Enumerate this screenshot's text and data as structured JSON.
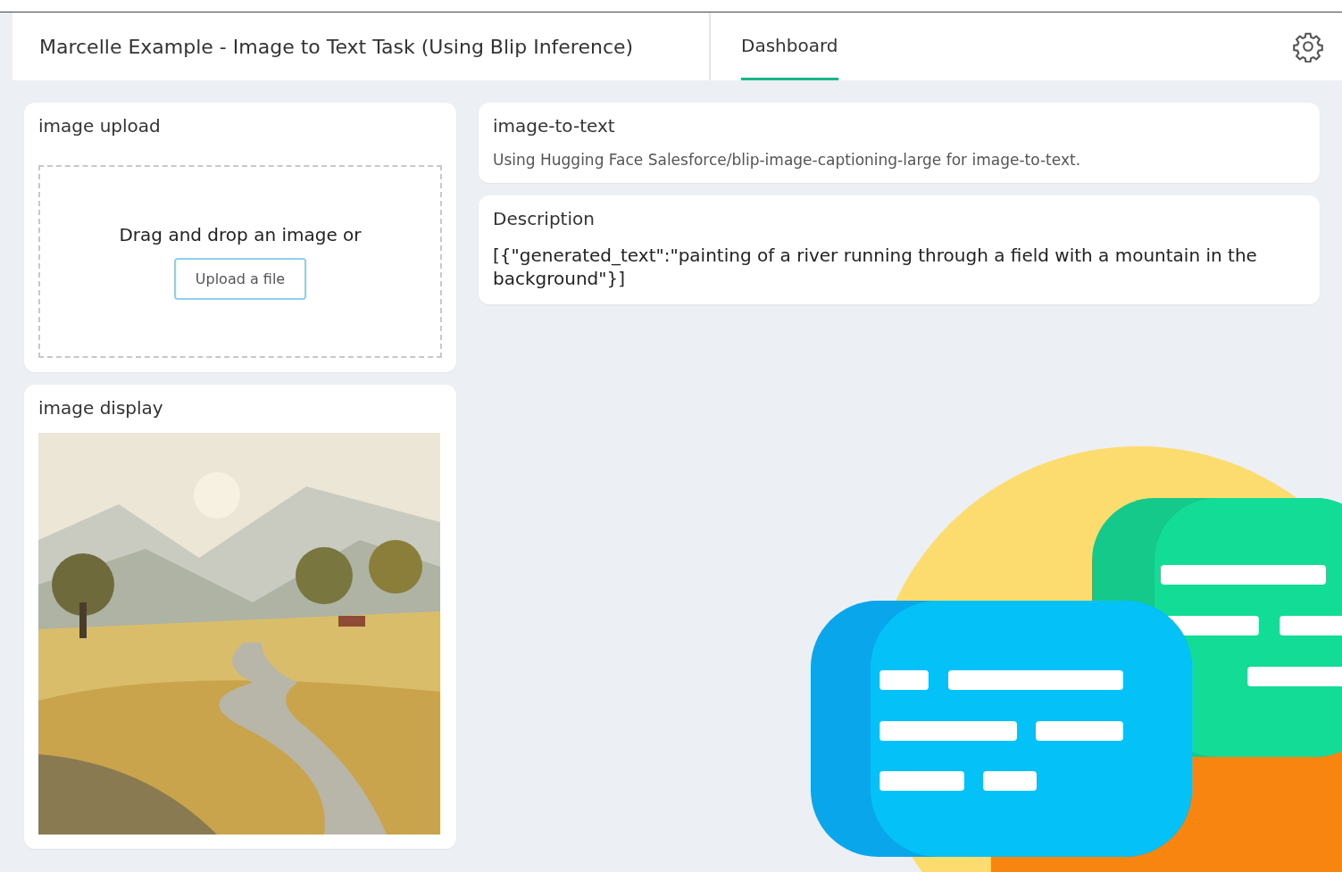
{
  "header": {
    "title": "Marcelle Example - Image to Text Task (Using Blip Inference)",
    "tabs": [
      {
        "label": "Dashboard",
        "selected": true
      }
    ]
  },
  "left": [
    {
      "kind": "upload",
      "title": "image upload",
      "prompt": "Drag and drop an image or",
      "button": "Upload a file"
    },
    {
      "title": "image display"
    }
  ],
  "right": [
    {
      "kind": "note",
      "title": "image-to-text",
      "text": "Using Hugging Face Salesforce/blip-image-captioning-large for image-to-text."
    },
    {
      "kind": "output",
      "title": "Description",
      "text": "[{\"generated_text\":\"painting of a river running through a field with a mountain in the background\"}]"
    }
  ]
}
